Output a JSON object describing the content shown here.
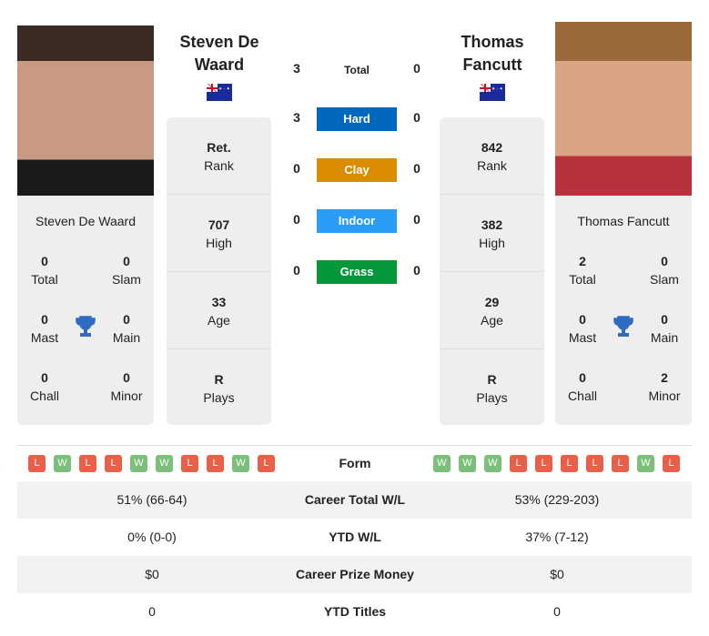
{
  "players": [
    {
      "name": "Steven De Waard",
      "title_line1": "Steven De",
      "title_line2": "Waard",
      "country": "Australia",
      "total": "0",
      "slam": "0",
      "mast": "0",
      "main": "0",
      "chall": "0",
      "minor": "0",
      "rank": "Ret.",
      "high": "707",
      "age": "33",
      "plays": "R",
      "form": [
        "L",
        "W",
        "L",
        "L",
        "W",
        "W",
        "L",
        "L",
        "W",
        "L"
      ],
      "career_wl": "51% (66-64)",
      "ytd_wl": "0% (0-0)",
      "prize": "$0",
      "ytd_titles": "0"
    },
    {
      "name": "Thomas Fancutt",
      "title_line1": "Thomas",
      "title_line2": "Fancutt",
      "country": "Australia",
      "total": "2",
      "slam": "0",
      "mast": "0",
      "main": "0",
      "chall": "0",
      "minor": "2",
      "rank": "842",
      "high": "382",
      "age": "29",
      "plays": "R",
      "form": [
        "W",
        "W",
        "W",
        "L",
        "L",
        "L",
        "L",
        "L",
        "W",
        "L"
      ],
      "career_wl": "53% (229-203)",
      "ytd_wl": "37% (7-12)",
      "prize": "$0",
      "ytd_titles": "0"
    }
  ],
  "labels": {
    "total": "Total",
    "slam": "Slam",
    "mast": "Mast",
    "main": "Main",
    "chall": "Chall",
    "minor": "Minor",
    "rank": "Rank",
    "high": "High",
    "age": "Age",
    "plays": "Plays",
    "form": "Form",
    "career_wl": "Career Total W/L",
    "ytd_wl": "YTD W/L",
    "prize": "Career Prize Money",
    "ytd_titles": "YTD Titles"
  },
  "h2h": [
    {
      "label": "Total",
      "left": "3",
      "right": "0",
      "color": ""
    },
    {
      "label": "Hard",
      "left": "3",
      "right": "0",
      "color": "#0068bd"
    },
    {
      "label": "Clay",
      "left": "0",
      "right": "0",
      "color": "#dc8c00"
    },
    {
      "label": "Indoor",
      "left": "0",
      "right": "0",
      "color": "#2a9cf5"
    },
    {
      "label": "Grass",
      "left": "0",
      "right": "0",
      "color": "#06973a"
    }
  ]
}
